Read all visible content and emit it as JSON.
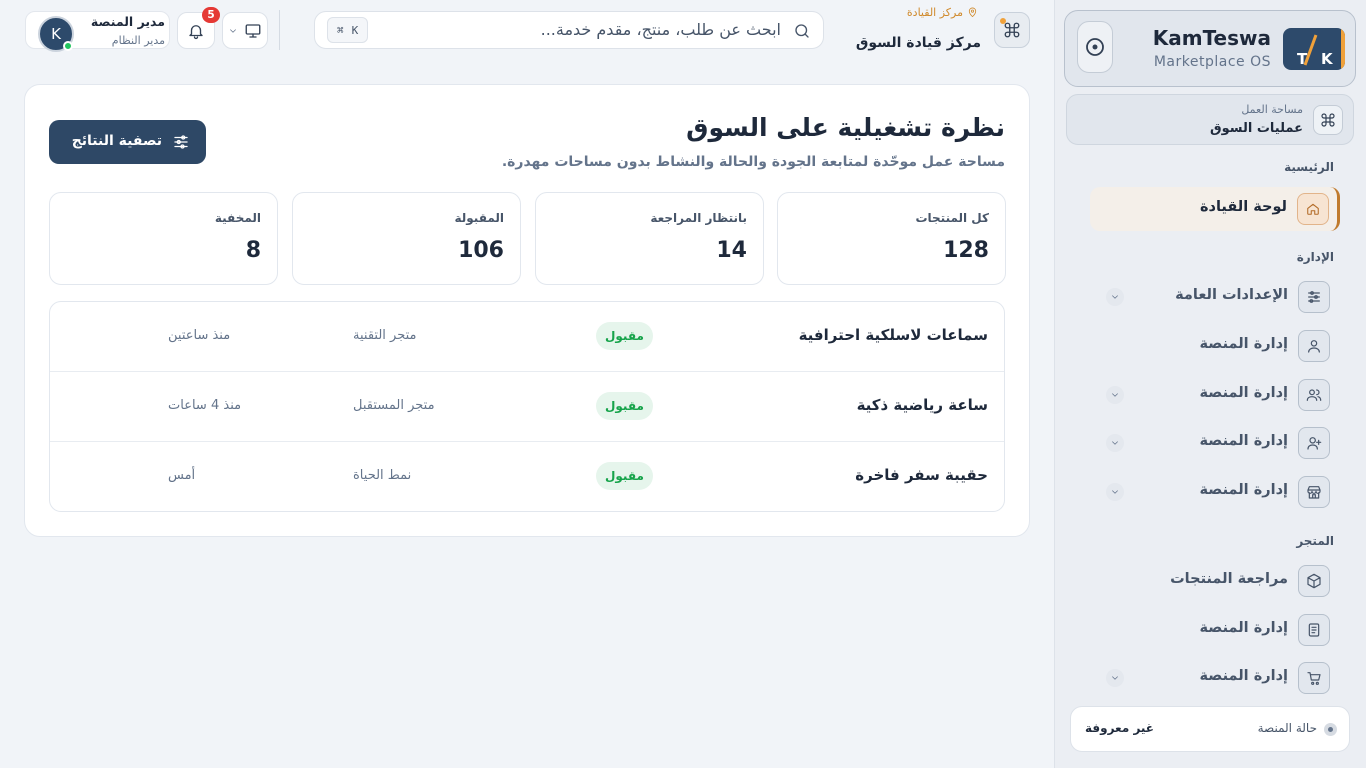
{
  "brand": {
    "name": "KamTeswa",
    "subtitle": "Marketplace OS",
    "logo_t": "T",
    "logo_k": "K"
  },
  "workspace": {
    "label": "مساحة العمل",
    "value": "عمليات السوق"
  },
  "sidebar": {
    "sections": {
      "main": "الرئيسية",
      "admin": "الإدارة",
      "store": "المتجر"
    },
    "items": [
      {
        "label": "لوحة القيادة",
        "icon": "home-icon"
      },
      {
        "label": "الإعدادات العامة",
        "icon": "sliders-icon"
      },
      {
        "label": "إدارة المنصة",
        "icon": "user-icon"
      },
      {
        "label": "إدارة المنصة",
        "icon": "users-icon"
      },
      {
        "label": "إدارة المنصة",
        "icon": "user-plus-icon"
      },
      {
        "label": "إدارة المنصة",
        "icon": "store-icon"
      },
      {
        "label": "مراجعة المنتجات",
        "icon": "box-icon"
      },
      {
        "label": "إدارة المنصة",
        "icon": "document-icon"
      },
      {
        "label": "إدارة المنصة",
        "icon": "cart-icon"
      }
    ],
    "status": {
      "label": "حالة المنصة",
      "value": "غير معروفة"
    }
  },
  "header": {
    "breadcrumb": "مركز القيادة",
    "title": "مركز قيادة السوق",
    "search_placeholder": "ابحث عن طلب، منتج، مقدم خدمة...",
    "shortcut_cmd": "⌘",
    "shortcut_key": "K",
    "notifications_count": "5",
    "user_name": "مدير المنصة",
    "user_role": "مدير النظام",
    "avatar_letter": "K"
  },
  "main": {
    "title": "نظرة تشغيلية على السوق",
    "subtitle": "مساحة عمل موحّدة لمتابعة الجودة والحالة والنشاط بدون مساحات مهدرة.",
    "filter_label": "تصفية النتائج",
    "stats": [
      {
        "label": "كل المنتجات",
        "value": "128"
      },
      {
        "label": "بانتظار المراجعة",
        "value": "14"
      },
      {
        "label": "المقبولة",
        "value": "106"
      },
      {
        "label": "المخفية",
        "value": "8"
      }
    ],
    "rows": [
      {
        "name": "سماعات لاسلكية احترافية",
        "status": "مقبول",
        "store": "متجر التقنية",
        "time": "منذ ساعتين"
      },
      {
        "name": "ساعة رياضية ذكية",
        "status": "مقبول",
        "store": "متجر المستقبل",
        "time": "منذ 4 ساعات"
      },
      {
        "name": "حقيبة سفر فاخرة",
        "status": "مقبول",
        "store": "نمط الحياة",
        "time": "أمس"
      }
    ]
  },
  "colors": {
    "brand_navy": "#2d4a6b",
    "accent_orange": "#f0a13a",
    "success_green": "#16a34a",
    "alert_red": "#e53935"
  }
}
